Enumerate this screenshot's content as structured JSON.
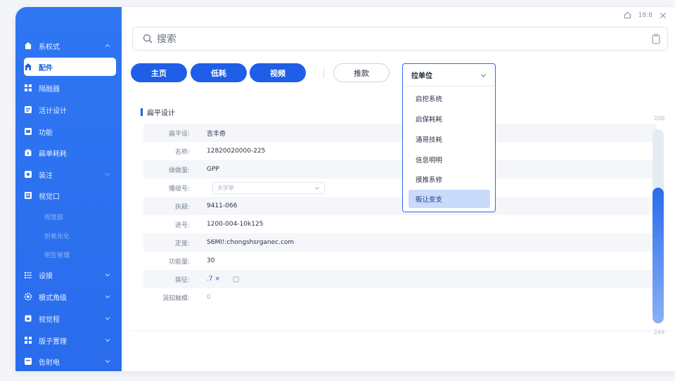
{
  "topbar": {
    "badge_text": "18:8"
  },
  "search": {
    "placeholder": "搜索"
  },
  "sidebar": {
    "items": [
      {
        "label": "系权式",
        "icon": "home-icon",
        "has_chevron": true
      },
      {
        "label": "配件",
        "icon": "home-icon",
        "active": true
      },
      {
        "label": "隔融器",
        "icon": "grid-icon"
      },
      {
        "label": "活计设计",
        "icon": "monitor-icon"
      },
      {
        "label": "功能",
        "icon": "monitor-icon"
      },
      {
        "label": "扁单耗耗",
        "icon": "bag-icon"
      },
      {
        "label": "装注",
        "icon": "chip-icon",
        "has_chevron": true
      },
      {
        "label": "视觉口",
        "icon": "grid-icon"
      }
    ],
    "subitems": [
      "视觉部",
      "扮氪化化",
      "明告管理"
    ],
    "groups": [
      {
        "label": "设摸",
        "icon": "list-icon"
      },
      {
        "label": "模式角级",
        "icon": "gear-icon"
      },
      {
        "label": "视觉程",
        "icon": "lock-icon"
      },
      {
        "label": "版子置理",
        "icon": "grid-icon"
      },
      {
        "label": "告射电",
        "icon": "monitor-icon"
      }
    ]
  },
  "toolbar": {
    "buttons": [
      "主页",
      "低耗",
      "视频"
    ],
    "outline_button": "推款"
  },
  "section": {
    "title": "扁平设计"
  },
  "form": {
    "rows": [
      {
        "label": "扁平设:",
        "value": "吉丰奇"
      },
      {
        "label": "名称:",
        "value": "12820020000-225"
      },
      {
        "label": "操做量:",
        "value": "GPP"
      },
      {
        "label": "播级号:",
        "value": "",
        "select": "大学单"
      },
      {
        "label": "执疑:",
        "value": "9411-066"
      },
      {
        "label": "进号:",
        "value": "1200-004-10k125"
      },
      {
        "label": "定度:",
        "value": "S6MI!:chongshsrganec.com"
      },
      {
        "label": "功能量:",
        "value": "30"
      },
      {
        "label": "装征:",
        "value": ".7  ×"
      },
      {
        "label": "涡知触模:",
        "value": "0",
        "muted": true
      }
    ]
  },
  "scroll": {
    "top_label": "200",
    "bottom_label": "269",
    "level_fraction": 0.7
  },
  "dropdown": {
    "selected_label": "拉单位",
    "options": [
      "启挖系统",
      "启保耗耗",
      "涌哥技耗",
      "信息明明",
      "摸推系修",
      "販让变支"
    ],
    "highlighted_index": 5
  },
  "colors": {
    "accent": "#1f5ee6",
    "sidebar": "#2f76f2",
    "highlight": "#c9dafb"
  }
}
